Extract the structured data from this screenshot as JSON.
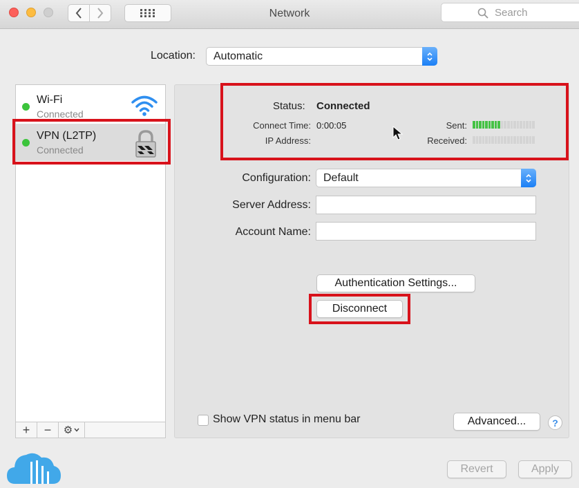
{
  "window": {
    "title": "Network",
    "search_placeholder": "Search"
  },
  "location": {
    "label": "Location:",
    "value": "Automatic"
  },
  "services": [
    {
      "name": "Wi-Fi",
      "status": "Connected",
      "icon": "wifi-icon"
    },
    {
      "name": "VPN (L2TP)",
      "status": "Connected",
      "icon": "lock-icon"
    }
  ],
  "sidebar_toolbar": {
    "add": "+",
    "remove": "−",
    "gear": "⚙"
  },
  "status": {
    "label": "Status:",
    "value": "Connected",
    "connect_time_label": "Connect Time:",
    "connect_time": "0:00:05",
    "ip_label": "IP Address:",
    "sent_label": "Sent:",
    "received_label": "Received:",
    "sent_level": 0.45,
    "received_level": 0
  },
  "form": {
    "configuration_label": "Configuration:",
    "configuration_value": "Default",
    "server_label": "Server Address:",
    "account_label": "Account Name:"
  },
  "buttons": {
    "auth": "Authentication Settings...",
    "disconnect": "Disconnect",
    "advanced": "Advanced...",
    "revert": "Revert",
    "apply": "Apply",
    "help": "?"
  },
  "show_vpn_label": "Show VPN status in menu bar",
  "colors": {
    "highlight": "#d8121b",
    "connected_dot": "#3cc43c",
    "accent": "#1b7ff5"
  }
}
